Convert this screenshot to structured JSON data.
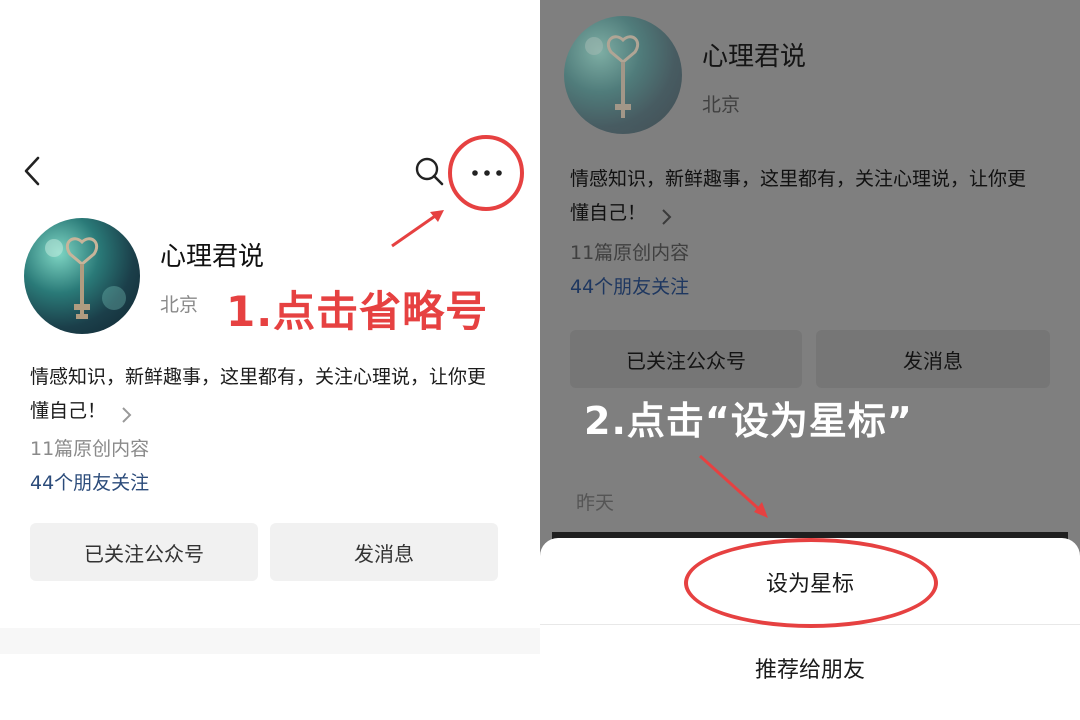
{
  "left": {
    "profile": {
      "name": "心理君说",
      "location": "北京",
      "description": "情感知识，新鲜趣事，这里都有，关注心理说，让你更懂自己！",
      "original_count": "11篇原创内容",
      "friends_following": "44个朋友关注"
    },
    "buttons": {
      "followed": "已关注公众号",
      "message": "发消息"
    },
    "annotation": "1.点击省略号"
  },
  "right": {
    "profile": {
      "name": "心理君说",
      "location": "北京",
      "description": "情感知识，新鲜趣事，这里都有，关注心理说，让你更懂自己！",
      "original_count": "11篇原创内容",
      "friends_following": "44个朋友关注"
    },
    "buttons": {
      "followed": "已关注公众号",
      "message": "发消息"
    },
    "date_label": "昨天",
    "annotation": "2.点击“设为星标”",
    "sheet": {
      "items": [
        "设为星标",
        "推荐给朋友"
      ]
    }
  },
  "colors": {
    "annotation_red": "#e64141",
    "friends_blue": "#2b4b7a",
    "overlay_gray": "#7f7f7f"
  },
  "icons": [
    "back-arrow-icon",
    "search-icon",
    "more-dots-icon",
    "chevron-right-icon"
  ]
}
